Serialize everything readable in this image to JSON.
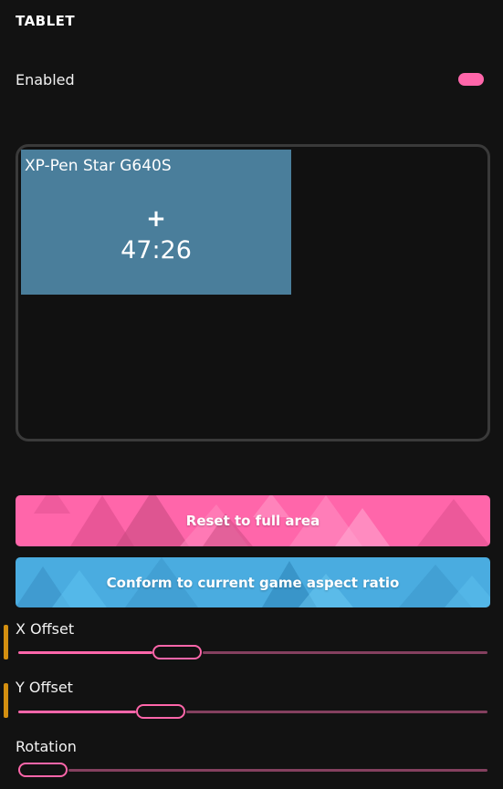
{
  "section": {
    "title": "TABLET"
  },
  "enabled": {
    "label": "Enabled",
    "on": true
  },
  "tablet": {
    "name": "XP-Pen Star G640S",
    "plus": "+",
    "ratio": "47:26"
  },
  "buttons": {
    "reset": "Reset to full area",
    "conform": "Conform to current game aspect ratio"
  },
  "sliders": [
    {
      "label": "X Offset",
      "level": 0.32
    },
    {
      "label": "Y Offset",
      "level": 0.28
    },
    {
      "label": "Rotation",
      "level": 0.0
    }
  ],
  "colors": {
    "accent": "#ff66aa",
    "blue": "#4aace0",
    "tablet_area": "#4a7e9b",
    "highlight": "#d48f10"
  }
}
